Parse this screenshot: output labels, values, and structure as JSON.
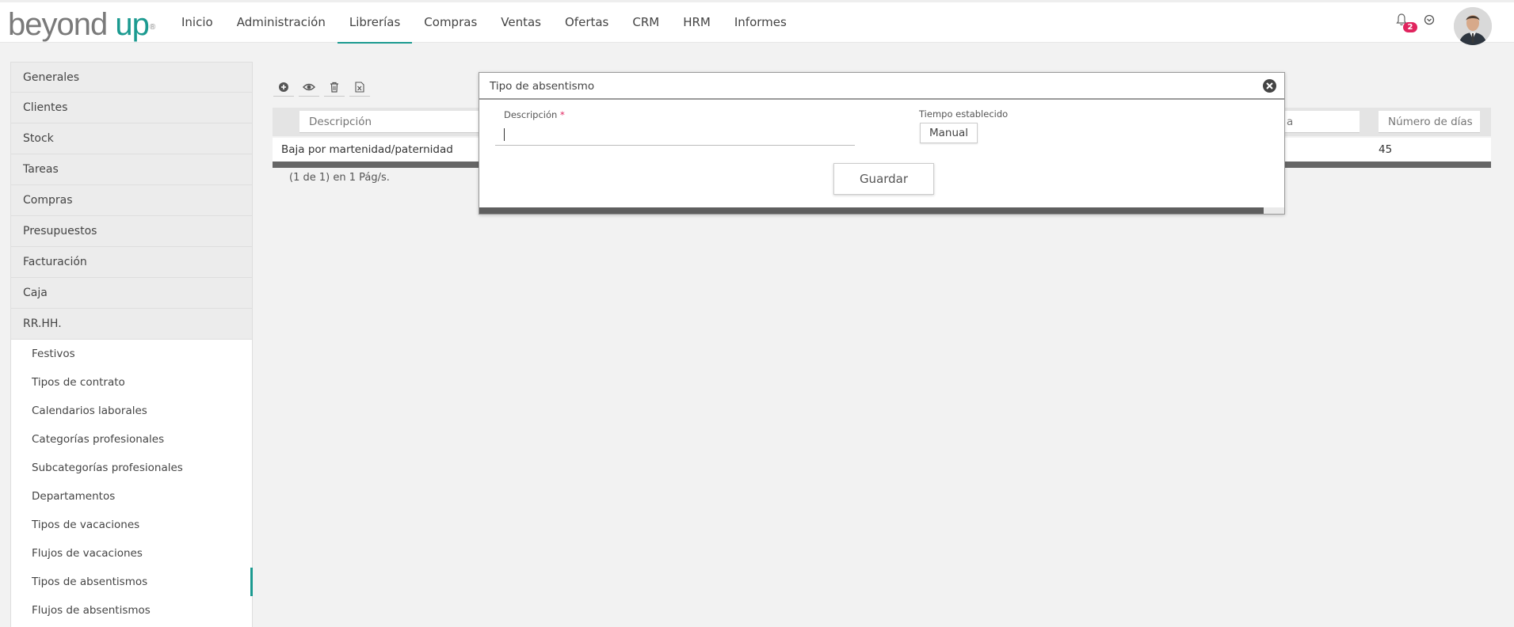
{
  "header": {
    "logo_part1": "beyond",
    "logo_part2": "up",
    "logo_reg": "®",
    "nav": [
      "Inicio",
      "Administración",
      "Librerías",
      "Compras",
      "Ventas",
      "Ofertas",
      "CRM",
      "HRM",
      "Informes"
    ],
    "active_nav": "Librerías",
    "notifications_count": "2",
    "accent_color": "#1b9a90"
  },
  "sidebar": {
    "sections": [
      "Generales",
      "Clientes",
      "Stock",
      "Tareas",
      "Compras",
      "Presupuestos",
      "Facturación",
      "Caja",
      "RR.HH."
    ],
    "rrhh_items": [
      "Festivos",
      "Tipos de contrato",
      "Calendarios laborales",
      "Categorías profesionales",
      "Subcategorías profesionales",
      "Departamentos",
      "Tipos de vacaciones",
      "Flujos de vacaciones",
      "Tipos de absentismos",
      "Flujos de absentismos"
    ],
    "active_item": "Tipos de absentismos"
  },
  "toolbar": {
    "icons": [
      "add-icon",
      "view-icon",
      "delete-icon",
      "excel-export-icon"
    ]
  },
  "grid": {
    "filter_placeholders": {
      "descripcion": "Descripción",
      "partial_column": "a",
      "numero_dias": "Número de días"
    },
    "rows": [
      {
        "descripcion": "Baja por martenidad/paternidad",
        "numero_dias": "45"
      }
    ],
    "pager": "(1 de 1) en 1 Pág/s."
  },
  "dialog": {
    "title": "Tipo de absentismo",
    "descripcion_label": "Descripción",
    "required_mark": "*",
    "descripcion_value": "",
    "tiempo_label": "Tiempo establecido",
    "manual_button": "Manual",
    "save_button": "Guardar"
  }
}
